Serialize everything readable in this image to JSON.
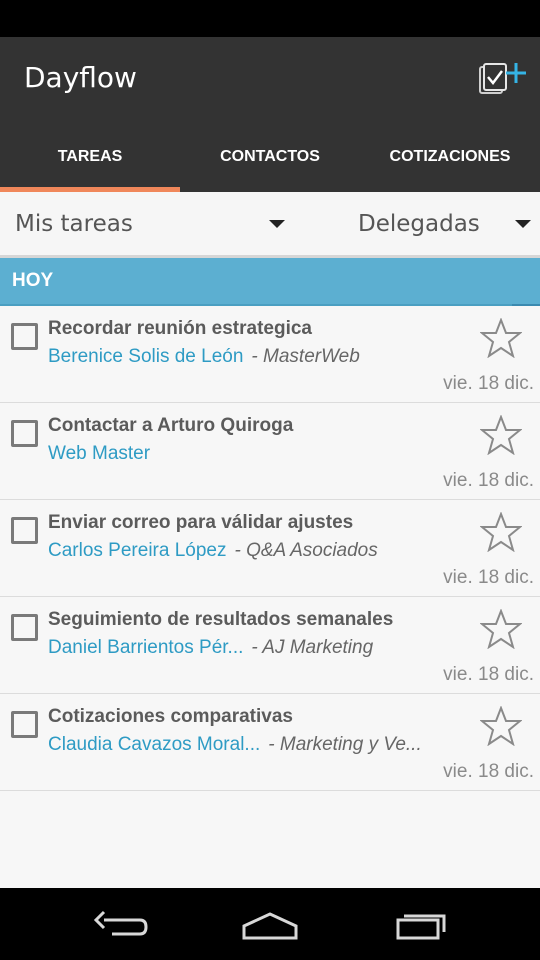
{
  "app": {
    "title": "Dayflow"
  },
  "tabs": [
    {
      "label": "TAREAS",
      "active": true
    },
    {
      "label": "CONTACTOS",
      "active": false
    },
    {
      "label": "COTIZACIONES",
      "active": false
    }
  ],
  "filters": {
    "left": "Mis tareas",
    "right": "Delegadas"
  },
  "section": {
    "title": "HOY"
  },
  "tasks": [
    {
      "title": "Recordar reunión estrategica",
      "contact": "Berenice Solis de León",
      "company": "- MasterWeb",
      "date": "vie. 18 dic."
    },
    {
      "title": "Contactar a Arturo Quiroga",
      "contact": "Web Master",
      "company": "",
      "date": "vie. 18 dic."
    },
    {
      "title": "Enviar correo para válidar ajustes",
      "contact": "Carlos Pereira López",
      "company": "- Q&A Asociados",
      "date": "vie. 18 dic."
    },
    {
      "title": "Seguimiento de resultados semanales",
      "contact": "Daniel Barrientos Pér...",
      "company": "- AJ Marketing",
      "date": "vie. 18 dic."
    },
    {
      "title": "Cotizaciones comparativas",
      "contact": "Claudia Cavazos Moral...",
      "company": "- Marketing y Ve...",
      "date": "vie. 18 dic."
    }
  ],
  "icons": {
    "add_task": "add-task-icon",
    "checkbox": "checkbox-icon",
    "star": "star-outline-icon",
    "back": "back-icon",
    "home": "home-icon",
    "recents": "recents-icon"
  },
  "colors": {
    "action_bar": "#333333",
    "tab_indicator": "#f0875a",
    "section_header": "#5cafd1",
    "contact_link": "#2e9bc4",
    "add_plus": "#35b4e6"
  }
}
